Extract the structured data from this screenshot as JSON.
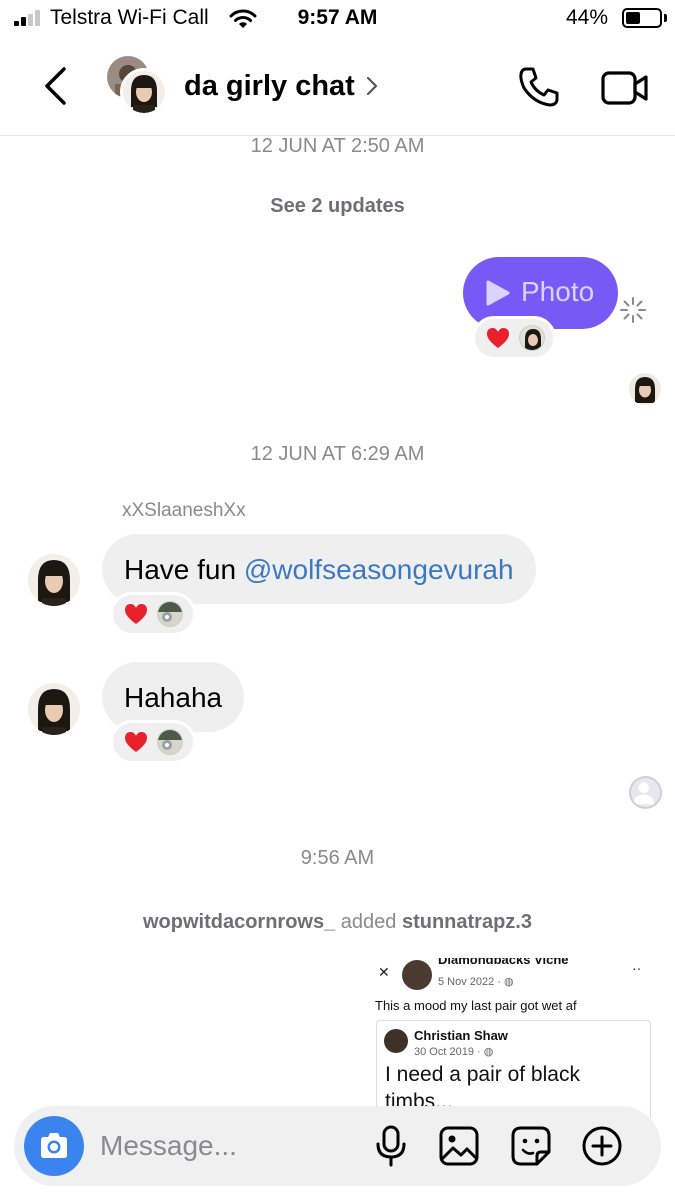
{
  "status_bar": {
    "carrier": "Telstra Wi-Fi Call",
    "time": "9:57 AM",
    "battery_percent": "44%",
    "battery_level": 0.44,
    "signal_icon": "cellular-signal-icon",
    "wifi_icon": "wifi-icon"
  },
  "header": {
    "title": "da girly chat",
    "back_icon": "chevron-left-icon",
    "call_icon": "phone-icon",
    "video_icon": "video-camera-icon"
  },
  "thread": {
    "timestamp_1": "12 JUN AT 2:50 AM",
    "updates_link": "See 2 updates",
    "photo_label": "Photo",
    "timestamp_2": "12 JUN AT 6:29 AM",
    "sender_name": "xXSlaaneshXx",
    "message_1_prefix": "Have fun ",
    "message_1_mention": "@wolfseasongevurah",
    "message_2": "Hahaha",
    "timestamp_3": "9:56 AM",
    "system_actor": "wopwitdacornrows_",
    "system_action": " added ",
    "system_target": "stunnatrapz.3",
    "reaction_emoji": "heart-icon"
  },
  "shared_post": {
    "author": "Diamondbacks Viche",
    "date": "5 Nov 2022 · ",
    "text": "This a mood my last pair got wet af",
    "quoted_author": "Christian Shaw",
    "quoted_date": "30 Oct 2019 · ",
    "quoted_text": "I need a pair of black timbs..."
  },
  "composer": {
    "placeholder": "Message...",
    "camera_icon": "camera-icon",
    "mic_icon": "microphone-icon",
    "gallery_icon": "gallery-icon",
    "sticker_icon": "sticker-icon",
    "add_icon": "plus-circle-icon"
  },
  "colors": {
    "photo_bubble": "#6c4cf5",
    "incoming_bubble": "#efefef",
    "mention": "#3b78c4",
    "camera_button": "#3a84f0"
  }
}
